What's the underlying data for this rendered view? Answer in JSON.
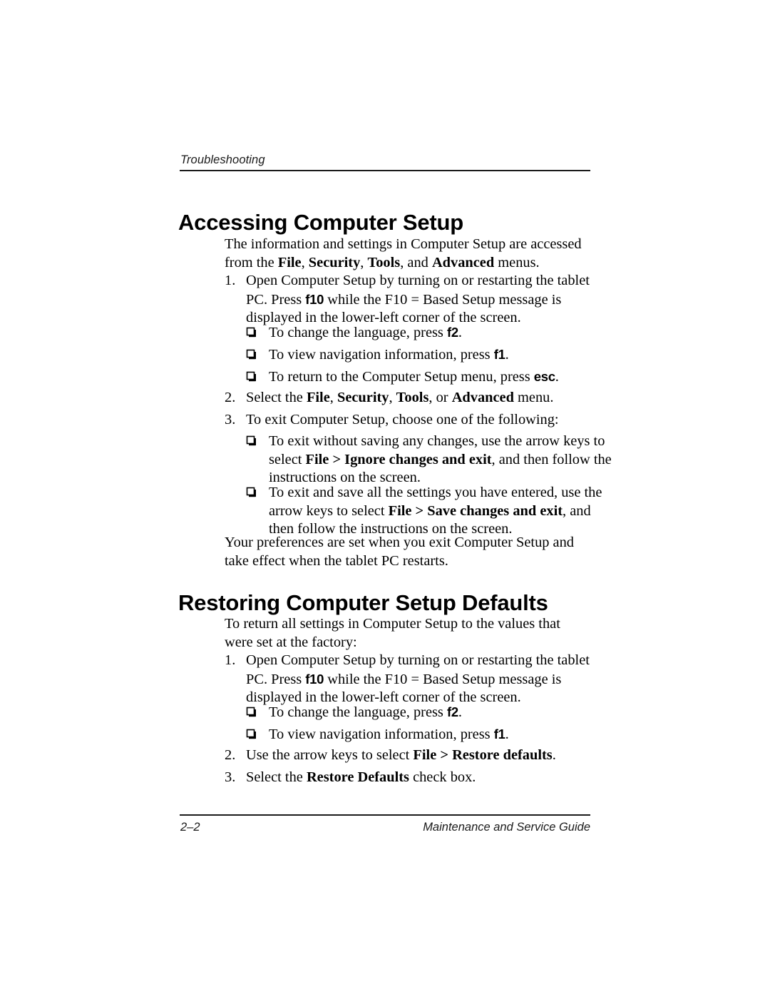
{
  "document": {
    "running_header": "Troubleshooting",
    "footer": {
      "page_number": "2–2",
      "guide_title": "Maintenance and Service Guide"
    },
    "bullet_glyph_name": "checkbox-bullet-icon"
  },
  "sections": [
    {
      "heading": "Accessing Computer Setup",
      "intro_para": {
        "p1": "The information and settings in Computer Setup are accessed from the ",
        "b1": "File",
        "p2": ", ",
        "b2": "Security",
        "p3": ", ",
        "b3": "Tools",
        "p4": ", and ",
        "b4": "Advanced",
        "p5": " menus."
      },
      "step1": {
        "marker": "1.",
        "t1": "Open Computer Setup by turning on or restarting the tablet PC. Press ",
        "key": "f10",
        "t2": " while the F10 = Based Setup message is displayed in the lower-left corner of the screen."
      },
      "bullets_a": [
        {
          "t1": "To change the language, press ",
          "key": "f2",
          "t2": "."
        },
        {
          "t1": "To view navigation information, press ",
          "key": "f1",
          "t2": "."
        },
        {
          "t1": "To return to the Computer Setup menu, press ",
          "key": "esc",
          "t2": "."
        }
      ],
      "step2": {
        "marker": "2.",
        "t1": "Select the ",
        "b1": "File",
        "t2": ", ",
        "b2": "Security",
        "t3": ", ",
        "b3": "Tools",
        "t4": ", or ",
        "b4": "Advanced",
        "t5": " menu."
      },
      "step3": {
        "marker": "3.",
        "t1": "To exit Computer Setup, choose one of the following:"
      },
      "bullets_b": [
        {
          "t1": "To exit without saving any changes, use the arrow keys to select ",
          "b1": "File > Ignore changes and exit",
          "t2": ", and then follow the instructions on the screen."
        },
        {
          "t1": "To exit and save all the settings you have entered, use the arrow keys to select ",
          "b1": "File > Save changes and exit",
          "t2": ", and then follow the instructions on the screen."
        }
      ],
      "closing_para": "Your preferences are set when you exit Computer Setup and take effect when the tablet PC restarts."
    },
    {
      "heading": "Restoring Computer Setup Defaults",
      "intro_para": "To return all settings in Computer Setup to the values that were set at the factory:",
      "step1": {
        "marker": "1.",
        "t1": "Open Computer Setup by turning on or restarting the tablet PC. Press ",
        "key": "f10",
        "t2": " while the F10 = Based Setup message is displayed in the lower-left corner of the screen."
      },
      "bullets_a": [
        {
          "t1": "To change the language, press ",
          "key": "f2",
          "t2": "."
        },
        {
          "t1": "To view navigation information, press ",
          "key": "f1",
          "t2": "."
        }
      ],
      "step2": {
        "marker": "2.",
        "t1": "Use the arrow keys to select ",
        "b1": "File > Restore defaults",
        "t2": "."
      },
      "step3": {
        "marker": "3.",
        "t1": "Select the ",
        "b1": "Restore Defaults",
        "t2": " check box."
      }
    }
  ]
}
